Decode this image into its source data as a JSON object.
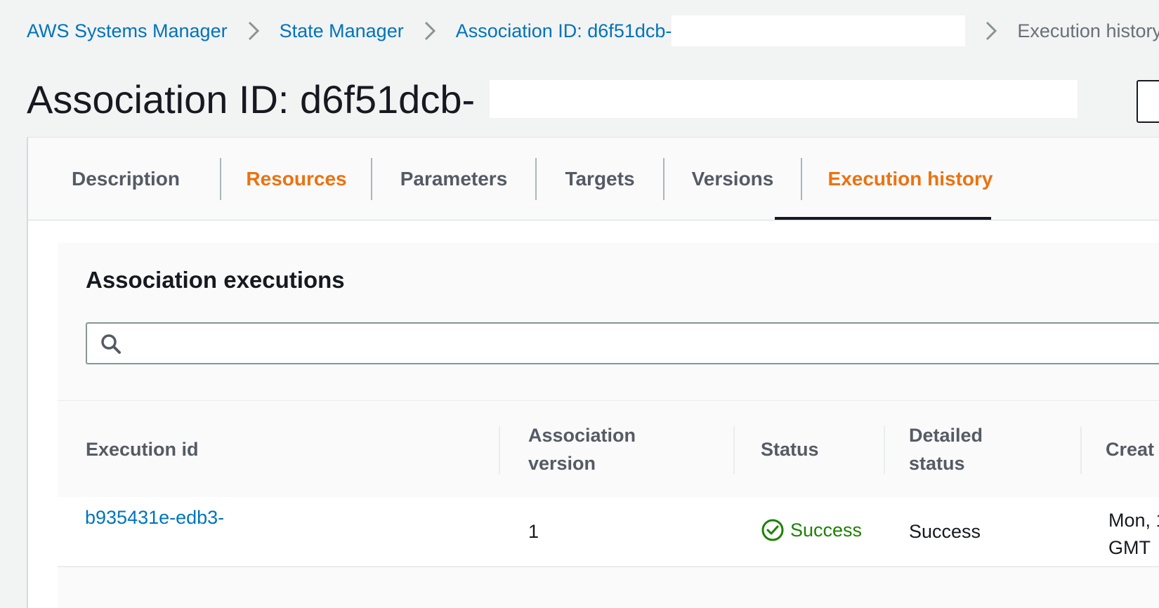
{
  "breadcrumb": {
    "items": [
      {
        "label": "AWS Systems Manager"
      },
      {
        "label": "State Manager"
      },
      {
        "label": "Association ID: d6f51dcb-"
      }
    ],
    "current": "Execution history"
  },
  "page": {
    "title": "Association ID: d6f51dcb-"
  },
  "tabs": [
    {
      "label": "Description",
      "active": false
    },
    {
      "label": "Resources",
      "active": false
    },
    {
      "label": "Parameters",
      "active": false
    },
    {
      "label": "Targets",
      "active": false
    },
    {
      "label": "Versions",
      "active": false
    },
    {
      "label": "Execution history",
      "active": true
    }
  ],
  "executions": {
    "title": "Association executions",
    "search_placeholder": "",
    "columns": {
      "execution_id": "Execution id",
      "association_version": "Association version",
      "status": "Status",
      "detailed_status": "Detailed status",
      "created": "Creat"
    },
    "rows": [
      {
        "execution_id": "b935431e-edb3-",
        "association_version": "1",
        "status": "Success",
        "detailed_status": "Success",
        "created_line1": "Mon, 1",
        "created_line2": "GMT"
      }
    ]
  },
  "icons": {
    "breadcrumb_separator": "chevron-right-icon",
    "search": "search-icon",
    "status": "check-circle-icon"
  },
  "colors": {
    "link": "#0073bb",
    "accent_orange": "#ec7211",
    "success_green": "#1d8102"
  }
}
